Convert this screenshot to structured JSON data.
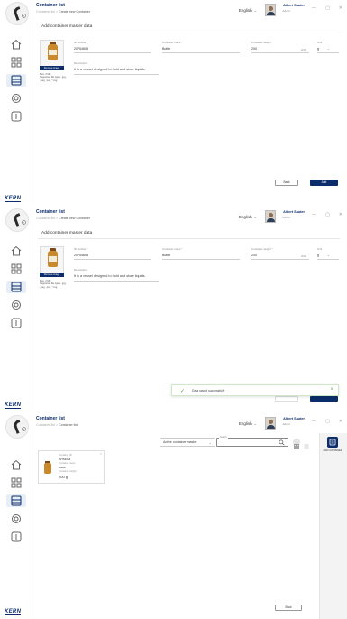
{
  "app": {
    "brand": "KERN",
    "language": "English",
    "user_name": "Albert Sauter",
    "user_role": "Admin",
    "window_controls": [
      "—",
      "▢",
      "✕"
    ]
  },
  "screen1": {
    "title": "Container list",
    "breadcrumb_parent": "Container list",
    "breadcrumb_sep": ">",
    "breadcrumb_current": "Create new Container",
    "section_title": "Add container master data",
    "image_button": "Remove image",
    "image_meta_name": "Max. 2 MB",
    "image_meta_formats": "Supported file types: .jpg, .jpeg, .png, *.svg",
    "id_label": "ID number *",
    "id_value": "20754654",
    "name_label": "Container name *",
    "name_value": "Bottle",
    "weight_label": "Container weight *",
    "weight_value": "200",
    "weight_unit_hint": "0/10",
    "unit_label": "Unit",
    "unit_value": "g",
    "desc_label": "Description",
    "desc_value": "It is a vessel designed to hold and store liquids.",
    "back_button": "Back",
    "add_button": "Add"
  },
  "screen2": {
    "title": "Container list",
    "breadcrumb_parent": "Container list",
    "breadcrumb_sep": ">",
    "breadcrumb_current": "Create new Container",
    "section_title": "Add container master data",
    "image_button": "Remove image",
    "image_meta_name": "Max. 2 MB",
    "image_meta_formats": "Supported file types: .jpg, .jpeg, .png, *.svg",
    "id_label": "ID number *",
    "id_value": "20754654",
    "name_label": "Container name *",
    "name_value": "Bottle",
    "weight_label": "Container weight *",
    "weight_value": "200",
    "weight_unit_hint": "0/10",
    "unit_label": "Unit",
    "unit_value": "g",
    "desc_label": "Description",
    "desc_value": "It is a vessel designed to hold and store liquids.",
    "toast_message": "Data saved successfully"
  },
  "screen3": {
    "title": "Container list",
    "breadcrumb_parent": "Container list",
    "breadcrumb_sep": ">",
    "breadcrumb_current": "Container list",
    "filter_value": "Active container master",
    "search_label": "Search",
    "add_label": "ADD CONTAINER",
    "card": {
      "id_label": "Container ID",
      "id_value": "20754654",
      "name_label": "Container name",
      "name_value": "Bottle",
      "weight_label": "Container weight",
      "weight_value": "200 g"
    },
    "back_button": "Back"
  },
  "colors": {
    "primary": "#0b2d6b",
    "success": "#5aaa52"
  }
}
